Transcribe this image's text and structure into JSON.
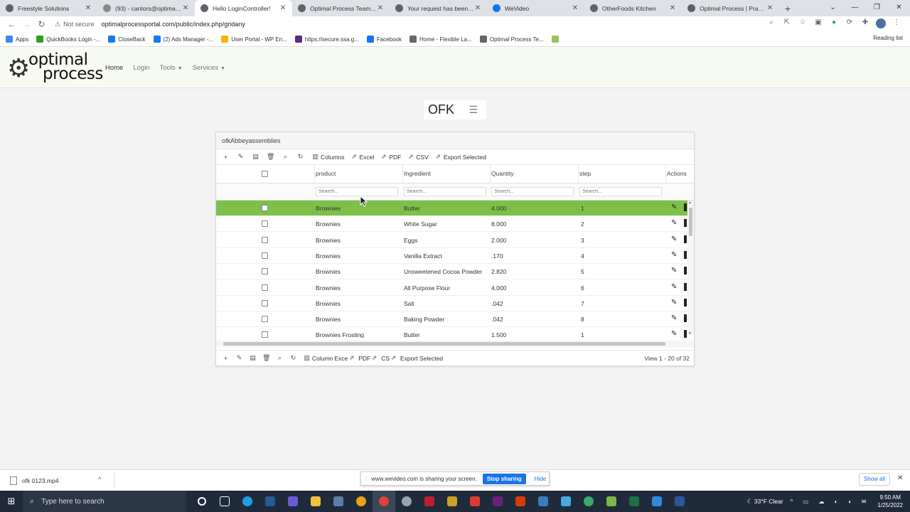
{
  "browser": {
    "tabs": [
      {
        "title": "Freestyle Solutions",
        "active": false,
        "color": "#5f6368"
      },
      {
        "title": "(93) - cantors@optimalpro",
        "active": false,
        "color": "#888888"
      },
      {
        "title": "Hello LoginController!",
        "active": true,
        "color": "#5f6368"
      },
      {
        "title": "Optimal Process Team Sha",
        "active": false,
        "color": "#5f6368"
      },
      {
        "title": "Your request has been sub",
        "active": false,
        "color": "#5f6368"
      },
      {
        "title": "WeVideo",
        "active": false,
        "color": "#1a73e8"
      },
      {
        "title": "OtherFoods Kitchen",
        "active": false,
        "color": "#5f6368"
      },
      {
        "title": "Optimal Process | Practica",
        "active": false,
        "color": "#5f6368"
      }
    ],
    "new_tab": "+",
    "security_label": "Not secure",
    "url": "optimalprocessportal.com/public/index.php/gridany",
    "bookmarks": [
      {
        "label": "Apps",
        "color": "#4285f4"
      },
      {
        "label": "QuickBooks Login -...",
        "color": "#2ca01c"
      },
      {
        "label": "CloseBack",
        "color": "#1877f2"
      },
      {
        "label": "(2) Ads Manager -...",
        "color": "#1877f2"
      },
      {
        "label": "User Portal - WP En...",
        "color": "#f4b400"
      },
      {
        "label": "https://secure.ssa.g...",
        "color": "#5b2c83"
      },
      {
        "label": "Facebook",
        "color": "#1877f2"
      },
      {
        "label": "Home - Flexible La...",
        "color": "#666666"
      },
      {
        "label": "Optimal Process Te...",
        "color": "#666666"
      },
      {
        "label": "",
        "color": "#9bc15a"
      }
    ],
    "reading_list": "Reading list"
  },
  "site": {
    "logo_line1": "optimal",
    "logo_line2": "process",
    "nav": {
      "home": "Home",
      "login": "Login",
      "tools": "Tools",
      "services": "Services"
    },
    "ofk_label": "OFK"
  },
  "grid": {
    "caption": "ofkAbbeyassemblies",
    "toolbar": {
      "columns": "Columns",
      "excel": "Excel",
      "pdf": "PDF",
      "csv": "CSV",
      "export_selected": "Export Selected"
    },
    "pager_toolbar": {
      "columns": "Column",
      "excel": "Exce",
      "pdf": "PDF",
      "csv": "CS",
      "export_selected": "Export Selected"
    },
    "columns": {
      "product": "product",
      "ingredient": "Ingredient",
      "quantity": "Quantity",
      "step": "step",
      "actions": "Actions"
    },
    "search_placeholder": "Search...",
    "selected_row_color": "#7cc04a",
    "rows": [
      {
        "product": "Brownies",
        "ingredient": "Butter",
        "quantity": "4.000",
        "step": "1"
      },
      {
        "product": "Brownies",
        "ingredient": "White Sugar",
        "quantity": "8.000",
        "step": "2"
      },
      {
        "product": "Brownies",
        "ingredient": "Eggs",
        "quantity": "2.000",
        "step": "3"
      },
      {
        "product": "Brownies",
        "ingredient": "Vanilla Extract",
        "quantity": ".170",
        "step": "4"
      },
      {
        "product": "Brownies",
        "ingredient": "Unsweetened Cocoa Powder",
        "quantity": "2.820",
        "step": "5"
      },
      {
        "product": "Brownies",
        "ingredient": "All Purpose Flour",
        "quantity": "4.000",
        "step": "6"
      },
      {
        "product": "Brownies",
        "ingredient": "Salt",
        "quantity": ".042",
        "step": "7"
      },
      {
        "product": "Brownies",
        "ingredient": "Baking Powder",
        "quantity": ".042",
        "step": "8"
      },
      {
        "product": "Brownies Frosting",
        "ingredient": "Butter",
        "quantity": "1.500",
        "step": "1"
      }
    ],
    "view_info": "View 1 - 20 of 32"
  },
  "downloads": {
    "file": "ofk 0123.mp4",
    "show_all": "Show all"
  },
  "sharing": {
    "message": "www.wevideo.com is sharing your screen.",
    "stop": "Stop sharing",
    "hide": "Hide"
  },
  "taskbar": {
    "search_placeholder": "Type here to search",
    "weather": "33°F  Clear",
    "time": "9:50 AM",
    "date": "1/25/2022"
  }
}
